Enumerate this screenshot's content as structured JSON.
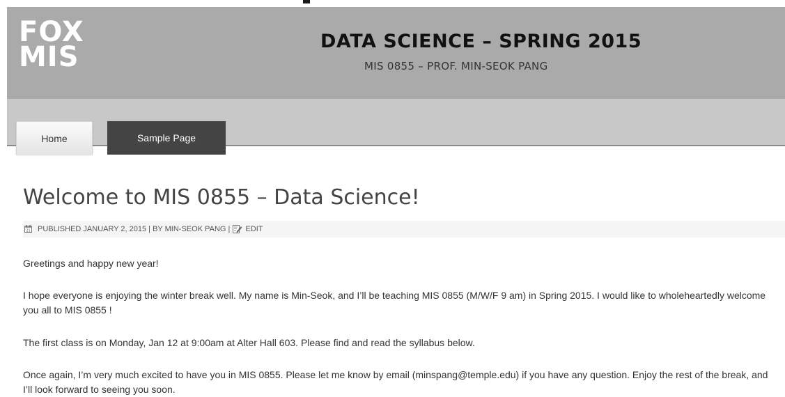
{
  "header": {
    "logo_line1": "FOX",
    "logo_line2": "MIS",
    "site_title": "DATA SCIENCE – SPRING 2015",
    "site_description": "MIS 0855 – PROF. MIN-SEOK PANG"
  },
  "nav": {
    "items": [
      {
        "label": "Home"
      },
      {
        "label": "Sample Page"
      }
    ]
  },
  "post": {
    "title": "Welcome to MIS 0855 – Data Science!",
    "meta": {
      "published_prefix": "PUBLISHED ",
      "date": "JANUARY 2, 2015",
      "by_prefix": " | BY ",
      "author": "MIN-SEOK PANG",
      "separator": " | ",
      "edit": "EDIT"
    },
    "paragraphs": [
      "Greetings and happy new year!",
      "I hope everyone is enjoying the winter break well. My name is Min-Seok, and I’ll be teaching MIS 0855 (M/W/F 9 am) in Spring 2015. I would like to wholeheartedly welcome you all to MIS 0855 !",
      "The first class is on Monday, Jan 12 at 9:00am at Alter Hall 603. Please find and read the syllabus below.",
      "Once again, I’m very much excited to have you in MIS 0855. Please let me know by email (minspang@temple.edu) if you have any question. Enjoy the rest of the break, and I’ll look forward to seeing you soon."
    ]
  },
  "colors": {
    "header_bg": "#aaaaaa",
    "nav_bg": "#c8c8c8",
    "active_tab_bg": "#444444"
  },
  "icons": {
    "calendar": "calendar-icon",
    "edit": "edit-pencil-icon"
  }
}
